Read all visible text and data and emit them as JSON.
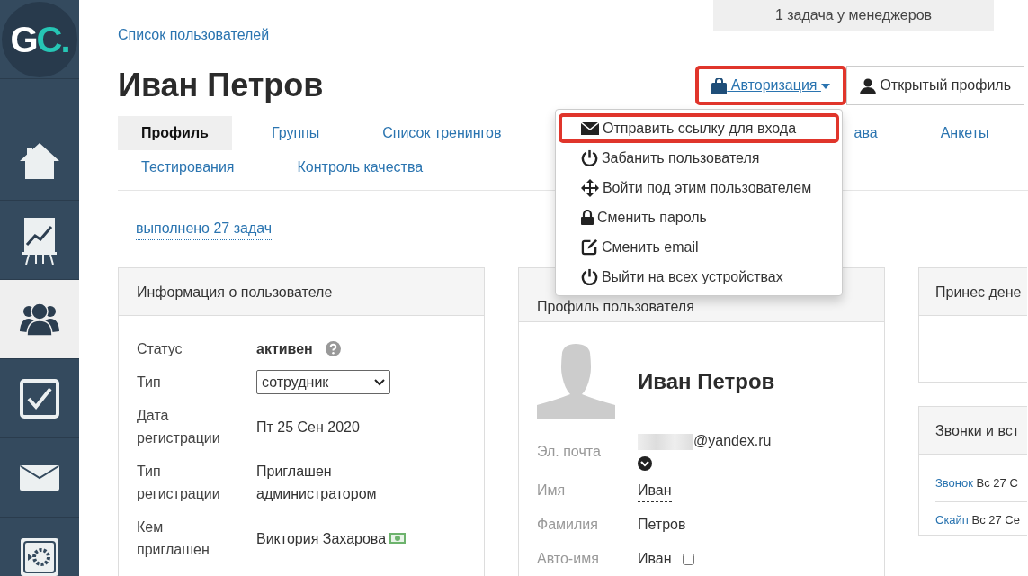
{
  "sidebar": {
    "logo": {
      "main": "G",
      "accent": "C."
    },
    "items": [
      {
        "kind": "blank",
        "selected": false
      },
      {
        "kind": "home",
        "selected": false
      },
      {
        "kind": "chart",
        "selected": false
      },
      {
        "kind": "users",
        "selected": true
      },
      {
        "kind": "tasks",
        "selected": false
      },
      {
        "kind": "mail",
        "selected": false
      },
      {
        "kind": "settings",
        "selected": false
      }
    ]
  },
  "breadcrumb": "Список пользователей",
  "manager_tasks": "1 задача у менеджеров",
  "title": "Иван Петров",
  "actions": [
    {
      "kind": "dropdown",
      "label": "Авторизация",
      "highlighted": true
    },
    {
      "kind": "profile",
      "label": "Открытый профиль",
      "highlighted": false
    }
  ],
  "auth_menu": [
    {
      "label": "Отправить ссылку для входа",
      "highlighted": true
    },
    {
      "label": "Забанить пользователя",
      "highlighted": false
    },
    {
      "label": "Войти под этим пользователем",
      "highlighted": false
    },
    {
      "label": "Сменить пароль",
      "highlighted": false
    },
    {
      "label": "Сменить email",
      "highlighted": false
    },
    {
      "label": "Выйти на всех устройствах",
      "highlighted": false
    }
  ],
  "tabs": [
    [
      {
        "label": "Профиль",
        "selected": true
      },
      {
        "label": "Группы",
        "selected": false
      },
      {
        "label": "Список тренингов",
        "selected": false
      },
      {
        "label": "ава",
        "selected": false
      },
      {
        "label": "Анкеты",
        "selected": false
      }
    ],
    [
      {
        "label": "Тестирования",
        "selected": false
      },
      {
        "label": "Контроль качества",
        "selected": false
      }
    ]
  ],
  "completed_tasks": "выполнено 27 задач",
  "user_info": {
    "title": "Информация о пользователе",
    "rows": [
      {
        "kind": "status",
        "label": "Статус",
        "value": "активен"
      },
      {
        "kind": "select",
        "label": "Тип",
        "value": "сотрудник"
      },
      {
        "kind": "text",
        "label": "Дата регистрации",
        "value": "Пт 25 Сен 2020"
      },
      {
        "kind": "text",
        "label": "Тип регистрации",
        "value": "Приглашен администратором"
      },
      {
        "kind": "inviter",
        "label": "Кем приглашен",
        "value": "Виктория Захарова"
      }
    ]
  },
  "user_profile": {
    "title": "Профиль пользователя",
    "name": "Иван Петров",
    "rows": [
      {
        "kind": "email",
        "label": "Эл. почта",
        "value": "@yandex.ru"
      },
      {
        "kind": "editable",
        "label": "Имя",
        "value": "Иван"
      },
      {
        "kind": "editable",
        "label": "Фамилия",
        "value": "Петров"
      },
      {
        "kind": "checkbox",
        "label": "Авто-имя",
        "value": "Иван",
        "checked": false
      }
    ]
  },
  "money_card": {
    "title": "Принес дене"
  },
  "calls_card": {
    "title": "Звонки и вст",
    "items": [
      {
        "link": "Звонок",
        "date": "Вс 27 С"
      },
      {
        "link": "Скайп",
        "date": "Вс 27 Се"
      }
    ]
  }
}
